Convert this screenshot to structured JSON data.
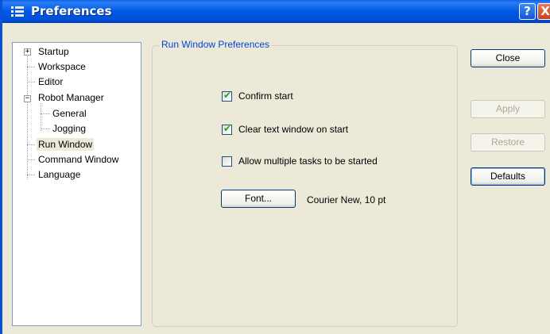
{
  "window": {
    "title": "Preferences"
  },
  "titlebar_buttons": {
    "help": "?",
    "close": "X"
  },
  "tree": {
    "items": [
      {
        "label": "Startup",
        "expander": "+"
      },
      {
        "label": "Workspace"
      },
      {
        "label": "Editor"
      },
      {
        "label": "Robot Manager",
        "expander": "−"
      },
      {
        "label": "General"
      },
      {
        "label": "Jogging"
      },
      {
        "label": "Run Window",
        "selected": true
      },
      {
        "label": "Command Window"
      },
      {
        "label": "Language"
      }
    ]
  },
  "group": {
    "title": "Run Window Preferences"
  },
  "options": [
    {
      "label": "Confirm start",
      "checked": true
    },
    {
      "label": "Clear text window on start",
      "checked": true
    },
    {
      "label": "Allow multiple tasks to be started",
      "checked": false
    }
  ],
  "font": {
    "button_label": "Font...",
    "value": "Courier New, 10 pt"
  },
  "buttons": {
    "close": "Close",
    "apply": "Apply",
    "restore": "Restore",
    "defaults": "Defaults"
  },
  "colors": {
    "titlebar": "#0058e6",
    "group_title": "#0046d5",
    "check_mark": "#21a121",
    "face": "#ece9d8"
  }
}
